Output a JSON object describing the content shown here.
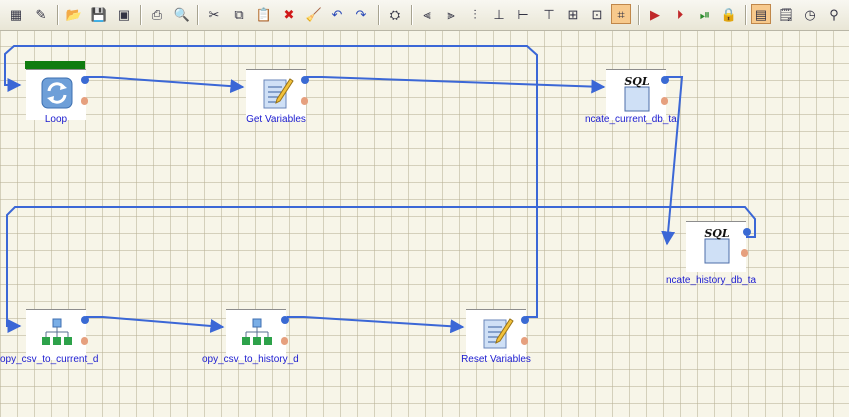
{
  "toolbar": {
    "buttons": [
      {
        "name": "job-properties-icon",
        "glyph": "▦"
      },
      {
        "name": "edit-properties-icon",
        "glyph": "✎"
      },
      {
        "name": "open-icon",
        "glyph": "📂"
      },
      {
        "name": "save-icon",
        "glyph": "💾"
      },
      {
        "name": "save-all-icon",
        "glyph": "▣"
      },
      {
        "name": "print-icon",
        "glyph": "⎙"
      },
      {
        "name": "print-preview-icon",
        "glyph": "🔍"
      },
      {
        "name": "cut-icon",
        "glyph": "✂"
      },
      {
        "name": "copy-icon",
        "glyph": "⧉"
      },
      {
        "name": "paste-icon",
        "glyph": "📋"
      },
      {
        "name": "delete-icon",
        "glyph": "✖"
      },
      {
        "name": "clean-icon",
        "glyph": "🧹"
      },
      {
        "name": "undo-icon",
        "glyph": "↶"
      },
      {
        "name": "redo-icon",
        "glyph": "↷"
      },
      {
        "name": "find-icon",
        "glyph": "⛭"
      },
      {
        "name": "align-left-icon",
        "glyph": "⫷"
      },
      {
        "name": "align-center-icon",
        "glyph": "⫸"
      },
      {
        "name": "align-right-icon",
        "glyph": "⫶"
      },
      {
        "name": "align-bottom-icon",
        "glyph": "⊥"
      },
      {
        "name": "align-middle-icon",
        "glyph": "⊢"
      },
      {
        "name": "align-top-icon",
        "glyph": "⊤"
      },
      {
        "name": "distribute-icon",
        "glyph": "⊞"
      },
      {
        "name": "same-size-icon",
        "glyph": "⊡"
      },
      {
        "name": "snap-to-grid-icon",
        "glyph": "⌗"
      },
      {
        "name": "run-icon",
        "glyph": "▶"
      },
      {
        "name": "run-from-icon",
        "glyph": "⏵"
      },
      {
        "name": "preview-icon",
        "glyph": "⏯"
      },
      {
        "name": "lock-icon",
        "glyph": "🔒"
      },
      {
        "name": "show-grid-icon",
        "glyph": "▤"
      },
      {
        "name": "show-notes-icon",
        "glyph": "🗒"
      },
      {
        "name": "zoom-icon",
        "glyph": "◷"
      },
      {
        "name": "binoculars-icon",
        "glyph": "⚲"
      }
    ]
  },
  "nodes": [
    {
      "id": "loop",
      "label": "Loop",
      "type": "loop-icon"
    },
    {
      "id": "get-variables",
      "label": "Get Variables",
      "type": "script-icon"
    },
    {
      "id": "truncate-current",
      "label": "ncate_current_db_ta",
      "type": "sql-icon",
      "icon_text": "SQL"
    },
    {
      "id": "truncate-history",
      "label": "ncate_history_db_ta",
      "type": "sql-icon",
      "icon_text": "SQL"
    },
    {
      "id": "copy-current",
      "label": "opy_csv_to_current_d",
      "type": "transform-icon"
    },
    {
      "id": "copy-history",
      "label": "opy_csv_to_history_d",
      "type": "transform-icon"
    },
    {
      "id": "reset-variables",
      "label": "Reset Variables",
      "type": "script-icon"
    }
  ],
  "colors": {
    "link": "#3b67d6",
    "canvas": "#f7f5e8",
    "grid": "#c9c2a6",
    "label": "#1b1bd0",
    "progress": "#0f7c0f"
  }
}
